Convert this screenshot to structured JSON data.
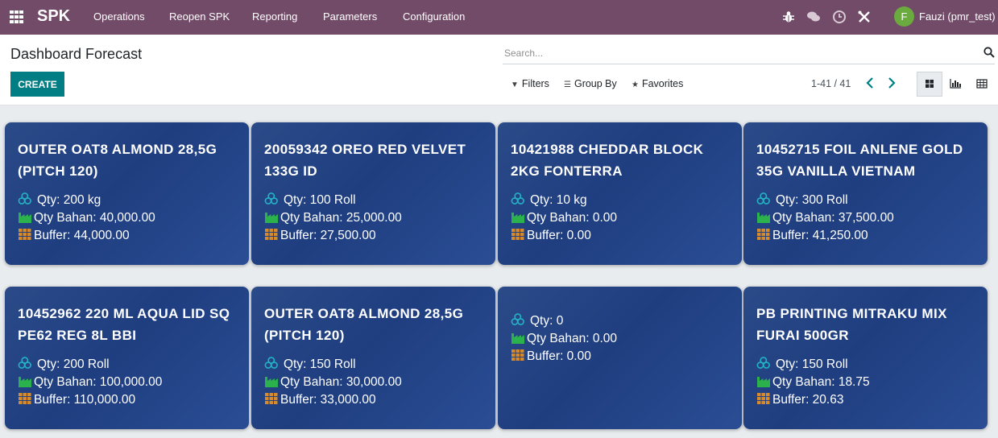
{
  "navbar": {
    "brand": "SPK",
    "menu": [
      "Operations",
      "Reopen SPK",
      "Reporting",
      "Parameters",
      "Configuration"
    ],
    "user_initial": "F",
    "user_name": "Fauzi (pmr_test)",
    "icons": [
      "bug-icon",
      "chat-icon",
      "clock-icon",
      "tools-icon"
    ]
  },
  "control": {
    "title": "Dashboard Forecast",
    "create_label": "CREATE",
    "search_placeholder": "Search...",
    "filters_label": "Filters",
    "groupby_label": "Group By",
    "favorites_label": "Favorites",
    "pager": "1-41 / 41"
  },
  "colors": {
    "navbar": "#714b67",
    "create_button": "#017e84",
    "card_background": "#24438a",
    "qty_icon": "#22b3c4",
    "bahan_icon": "#2bb24c",
    "buffer_icon": "#d58b2b"
  },
  "cards": [
    {
      "title": "OUTER OAT8 ALMOND 28,5G (PITCH 120)",
      "qty": "Qty: 200 kg",
      "bahan": "Qty Bahan: 40,000.00",
      "buffer": "Buffer: 44,000.00"
    },
    {
      "title": "20059342 OREO RED VELVET 133G ID",
      "qty": "Qty: 100 Roll",
      "bahan": "Qty Bahan: 25,000.00",
      "buffer": "Buffer: 27,500.00"
    },
    {
      "title": "10421988 CHEDDAR BLOCK 2KG FONTERRA",
      "qty": "Qty: 10 kg",
      "bahan": "Qty Bahan: 0.00",
      "buffer": "Buffer: 0.00"
    },
    {
      "title": "10452715 FOIL ANLENE GOLD 35G VANILLA VIETNAM",
      "qty": "Qty: 300 Roll",
      "bahan": "Qty Bahan: 37,500.00",
      "buffer": "Buffer: 41,250.00"
    },
    {
      "title": "10452962 220 ML AQUA LID SQ PE62 REG 8L BBI",
      "qty": "Qty: 200 Roll",
      "bahan": "Qty Bahan: 100,000.00",
      "buffer": "Buffer: 110,000.00"
    },
    {
      "title": "OUTER OAT8 ALMOND 28,5G (PITCH 120)",
      "qty": "Qty: 150 Roll",
      "bahan": "Qty Bahan: 30,000.00",
      "buffer": "Buffer: 33,000.00"
    },
    {
      "title": "",
      "qty": "Qty: 0",
      "bahan": "Qty Bahan: 0.00",
      "buffer": "Buffer: 0.00"
    },
    {
      "title": "PB PRINTING MITRAKU MIX FURAI 500GR",
      "qty": "Qty: 150 Roll",
      "bahan": "Qty Bahan: 18.75",
      "buffer": "Buffer: 20.63"
    }
  ]
}
